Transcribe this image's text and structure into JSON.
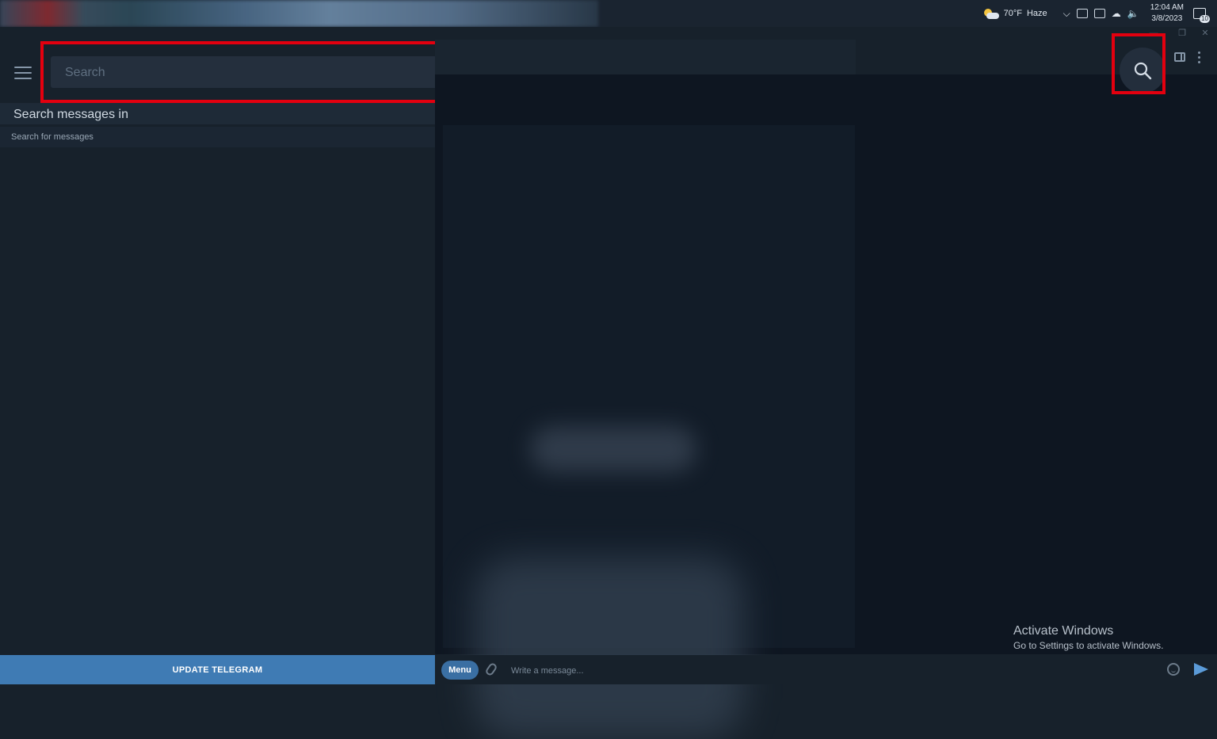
{
  "tray": {
    "temperature": "70°F",
    "condition": "Haze",
    "time": "12:04 AM",
    "date": "3/8/2023",
    "notifications": "10"
  },
  "left_panel": {
    "search_placeholder": "Search",
    "search_messages_in": "Search messages in",
    "search_for_messages": "Search for messages",
    "update_button": "UPDATE TELEGRAM"
  },
  "composer": {
    "menu_label": "Menu",
    "message_placeholder": "Write a message..."
  },
  "watermark": {
    "title": "Activate Windows",
    "subtitle": "Go to Settings to activate Windows."
  },
  "colors": {
    "highlight": "#e3000f",
    "accent": "#3f7bb4",
    "background": "#17212b"
  },
  "icons": [
    "menu-icon",
    "calendar-icon",
    "search-icon",
    "sidebar-toggle-icon",
    "more-icon",
    "attach-icon",
    "emoji-icon",
    "send-icon",
    "weather-icon"
  ]
}
